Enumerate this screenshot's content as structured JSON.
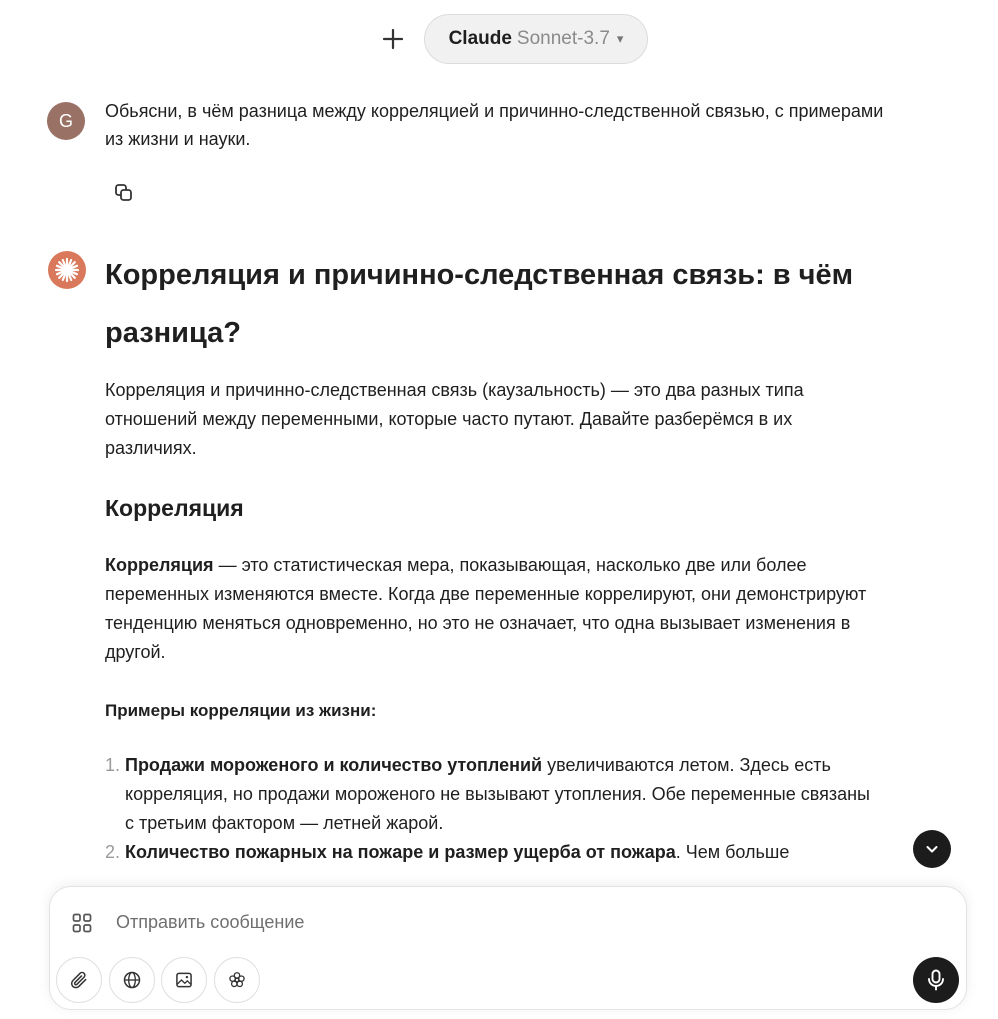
{
  "header": {
    "model_name": "Claude",
    "model_version": "Sonnet-3.7",
    "chevron": "▾"
  },
  "user": {
    "avatar_letter": "G",
    "message": "Обьясни, в чём разница между корреляцией и причинно-следственной связью, с примерами из жизни и науки."
  },
  "response": {
    "title": "Корреляция и причинно-следственная связь: в чём разница?",
    "intro": "Корреляция и причинно-следственная связь (каузальность) — это два разных типа отношений между переменными, которые часто путают. Давайте разберёмся в их различиях.",
    "section1": {
      "heading": "Корреляция",
      "definition_term": "Корреляция",
      "definition_text": " — это статистическая мера, показывающая, насколько две или более переменных изменяются вместе. Когда две переменные коррелируют, они демонстрируют тенденцию меняться одновременно, но это не означает, что одна вызывает изменения в другой.",
      "examples_heading": "Примеры корреляции из жизни:",
      "examples": [
        {
          "bold": "Продажи мороженого и количество утоплений",
          "text": " увеличиваются летом. Здесь есть корреляция, но продажи мороженого не вызывают утопления. Обе переменные связаны с третьим фактором — летней жарой."
        },
        {
          "bold": "Количество пожарных на пожаре и размер ущерба от пожара",
          "text": ". Чем больше"
        }
      ]
    }
  },
  "composer": {
    "placeholder": "Отправить сообщение"
  },
  "icons": {
    "new_chat": "plus-icon",
    "copy": "copy-icon",
    "claude": "claude-starburst-icon",
    "scroll_down": "chevron-down-icon",
    "apps": "apps-grid-icon",
    "attach": "paperclip-icon",
    "web": "globe-icon",
    "image": "image-icon",
    "tools": "flower-icon",
    "mic": "microphone-icon"
  },
  "colors": {
    "user_avatar": "#9a7265",
    "claude_avatar": "#d9785a",
    "dark_button": "#1c1c1c"
  }
}
